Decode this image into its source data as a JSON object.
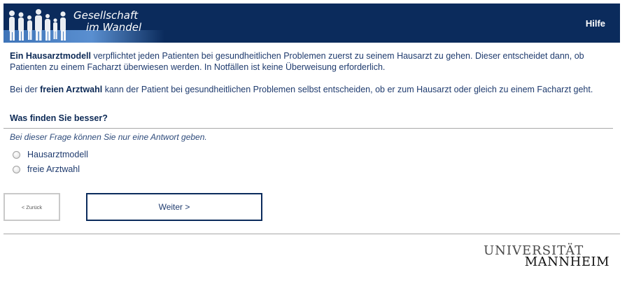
{
  "header": {
    "logo_line1": "Gesellschaft",
    "logo_line2": "im Wandel",
    "help_label": "Hilfe",
    "colors": {
      "background": "#0b2b5c",
      "band": "#3e74b8"
    }
  },
  "intro": {
    "p1_bold": "Ein Hausarztmodell",
    "p1_text": " verpflichtet jeden Patienten bei gesundheitlichen Problemen zuerst zu seinem Hausarzt zu gehen. Dieser entscheidet dann, ob Patienten zu einem Facharzt überwiesen werden. In Notfällen ist keine Überweisung erforderlich.",
    "p2_prefix": "Bei der ",
    "p2_bold": "freien Arztwahl",
    "p2_text": " kann der Patient bei gesundheitlichen Problemen selbst entscheiden, ob er zum Hausarzt oder gleich zu einem Facharzt geht."
  },
  "question": {
    "text": "Was finden Sie besser?",
    "instruction": "Bei dieser Frage können Sie nur eine Antwort geben.",
    "options": [
      {
        "label": "Hausarztmodell",
        "selected": false
      },
      {
        "label": "freie Arztwahl",
        "selected": false
      }
    ]
  },
  "nav": {
    "back_label": "< Zurück",
    "next_label": "Weiter >"
  },
  "footer": {
    "logo_line1": "UNIVERSITÄT",
    "logo_line2": "MANNHEIM"
  }
}
